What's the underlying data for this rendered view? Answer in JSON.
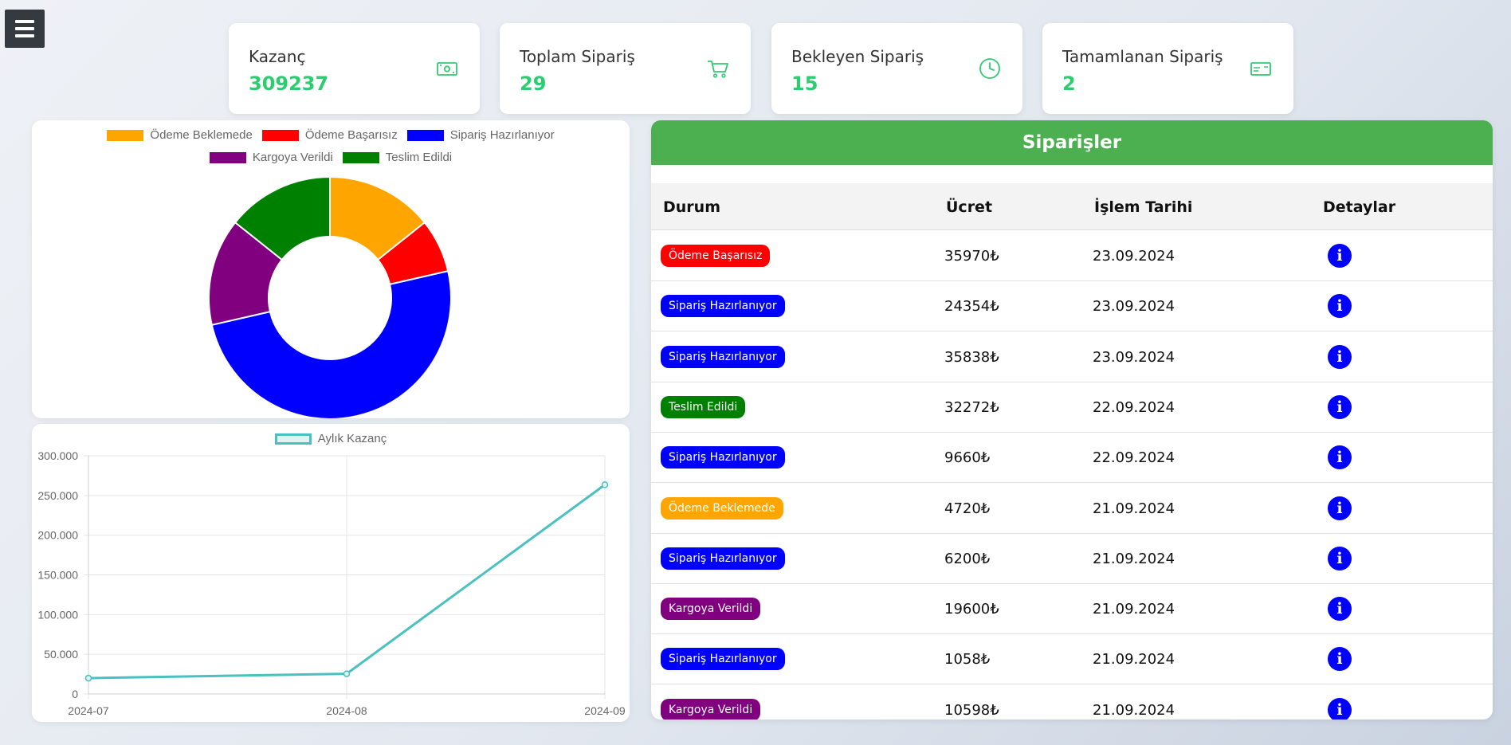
{
  "colors": {
    "accent": "#4caf50",
    "stat_value": "#2ecc71",
    "line": "#4bc0c0",
    "status": {
      "Ödeme Beklemede": "#ffa500",
      "Ödeme Başarısız": "#ff0000",
      "Sipariş Hazırlanıyor": "#0000ff",
      "Kargoya Verildi": "#800080",
      "Teslim Edildi": "#008000"
    }
  },
  "stats": [
    {
      "label": "Kazanç",
      "value": "309237",
      "icon": "money-icon"
    },
    {
      "label": "Toplam Sipariş",
      "value": "29",
      "icon": "cart-icon"
    },
    {
      "label": "Bekleyen Sipariş",
      "value": "15",
      "icon": "clock-icon"
    },
    {
      "label": "Tamamlanan Sipariş",
      "value": "2",
      "icon": "card-icon"
    }
  ],
  "chart_data": [
    {
      "type": "pie",
      "labels": [
        "Ödeme Beklemede",
        "Ödeme Başarısız",
        "Sipariş Hazırlanıyor",
        "Kargoya Verildi",
        "Teslim Edildi"
      ],
      "values": [
        4,
        2,
        14,
        4,
        4
      ],
      "colors": [
        "#ffa500",
        "#ff0000",
        "#0000ff",
        "#800080",
        "#008000"
      ],
      "legend": "top",
      "title": ""
    },
    {
      "type": "line",
      "legend_label": "Aylık Kazanç",
      "x": [
        "2024-07",
        "2024-08",
        "2024-09"
      ],
      "values": [
        20000,
        25500,
        263500
      ],
      "ylim": [
        0,
        300000
      ],
      "yticks": [
        "0",
        "50.000",
        "100.000",
        "150.000",
        "200.000",
        "250.000",
        "300.000"
      ],
      "grid": true,
      "legend": "top",
      "title": ""
    }
  ],
  "orders": {
    "title": "Siparişler",
    "columns": [
      "Durum",
      "Ücret",
      "İşlem Tarihi",
      "Detaylar"
    ],
    "rows": [
      {
        "status": "Ödeme Başarısız",
        "price": "35970₺",
        "date": "23.09.2024"
      },
      {
        "status": "Sipariş Hazırlanıyor",
        "price": "24354₺",
        "date": "23.09.2024"
      },
      {
        "status": "Sipariş Hazırlanıyor",
        "price": "35838₺",
        "date": "23.09.2024"
      },
      {
        "status": "Teslim Edildi",
        "price": "32272₺",
        "date": "22.09.2024"
      },
      {
        "status": "Sipariş Hazırlanıyor",
        "price": "9660₺",
        "date": "22.09.2024"
      },
      {
        "status": "Ödeme Beklemede",
        "price": "4720₺",
        "date": "21.09.2024"
      },
      {
        "status": "Sipariş Hazırlanıyor",
        "price": "6200₺",
        "date": "21.09.2024"
      },
      {
        "status": "Kargoya Verildi",
        "price": "19600₺",
        "date": "21.09.2024"
      },
      {
        "status": "Sipariş Hazırlanıyor",
        "price": "1058₺",
        "date": "21.09.2024"
      },
      {
        "status": "Kargoya Verildi",
        "price": "10598₺",
        "date": "21.09.2024"
      }
    ]
  }
}
